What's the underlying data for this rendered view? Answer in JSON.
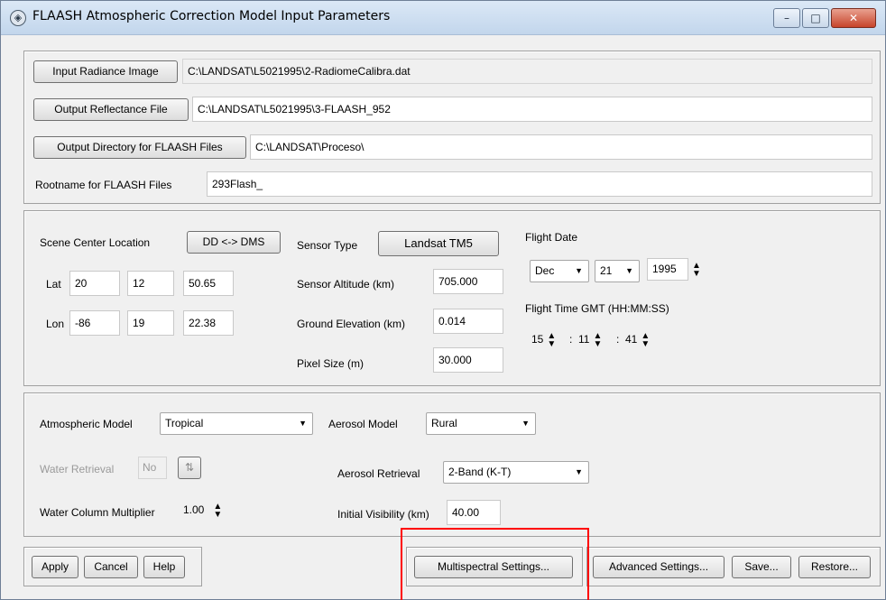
{
  "window": {
    "title": "FLAASH Atmospheric Correction Model Input Parameters",
    "minimize": "–",
    "maximize": "□",
    "close": "✕"
  },
  "files": {
    "input_radiance_button": "Input Radiance Image",
    "input_radiance_value": "C:\\LANDSAT\\L5021995\\2-RadiomeCalibra.dat",
    "output_reflectance_button": "Output Reflectance File",
    "output_reflectance_value": "C:\\LANDSAT\\L5021995\\3-FLAASH_952",
    "output_directory_button": "Output Directory for FLAASH Files",
    "output_directory_value": "C:\\LANDSAT\\Proceso\\",
    "rootname_label": "Rootname for FLAASH Files",
    "rootname_value": "293Flash_"
  },
  "scene": {
    "center_label": "Scene Center Location",
    "dd_dms_button": "DD <-> DMS",
    "lat_label": "Lat",
    "lat": [
      "20",
      "12",
      "50.65"
    ],
    "lon_label": "Lon",
    "lon": [
      "-86",
      "19",
      "22.38"
    ],
    "sensor_type_label": "Sensor Type",
    "sensor_type_button": "Landsat TM5",
    "sensor_altitude_label": "Sensor Altitude (km)",
    "sensor_altitude": "705.000",
    "ground_elevation_label": "Ground Elevation (km)",
    "ground_elevation": "0.014",
    "pixel_size_label": "Pixel Size (m)",
    "pixel_size": "30.000",
    "flight_date_label": "Flight Date",
    "month": "Dec",
    "day": "21",
    "year": "1995",
    "flight_time_label": "Flight Time GMT (HH:MM:SS)",
    "hh": "15",
    "mm": "11",
    "ss": "41",
    "colon": ":"
  },
  "atmosphere": {
    "model_label": "Atmospheric Model",
    "model_value": "Tropical",
    "aerosol_model_label": "Aerosol Model",
    "aerosol_model_value": "Rural",
    "water_retrieval_label": "Water Retrieval",
    "water_retrieval_value": "No",
    "aerosol_retrieval_label": "Aerosol Retrieval",
    "aerosol_retrieval_value": "2-Band (K-T)",
    "water_column_label": "Water Column Multiplier",
    "water_column_value": "1.00",
    "initial_visibility_label": "Initial Visibility (km)",
    "initial_visibility_value": "40.00"
  },
  "footer": {
    "apply": "Apply",
    "cancel": "Cancel",
    "help": "Help",
    "multispectral": "Multispectral Settings...",
    "advanced": "Advanced Settings...",
    "save": "Save...",
    "restore": "Restore..."
  },
  "colors": {
    "highlight_box": "#ff0000",
    "close_button": "#c7442b"
  }
}
